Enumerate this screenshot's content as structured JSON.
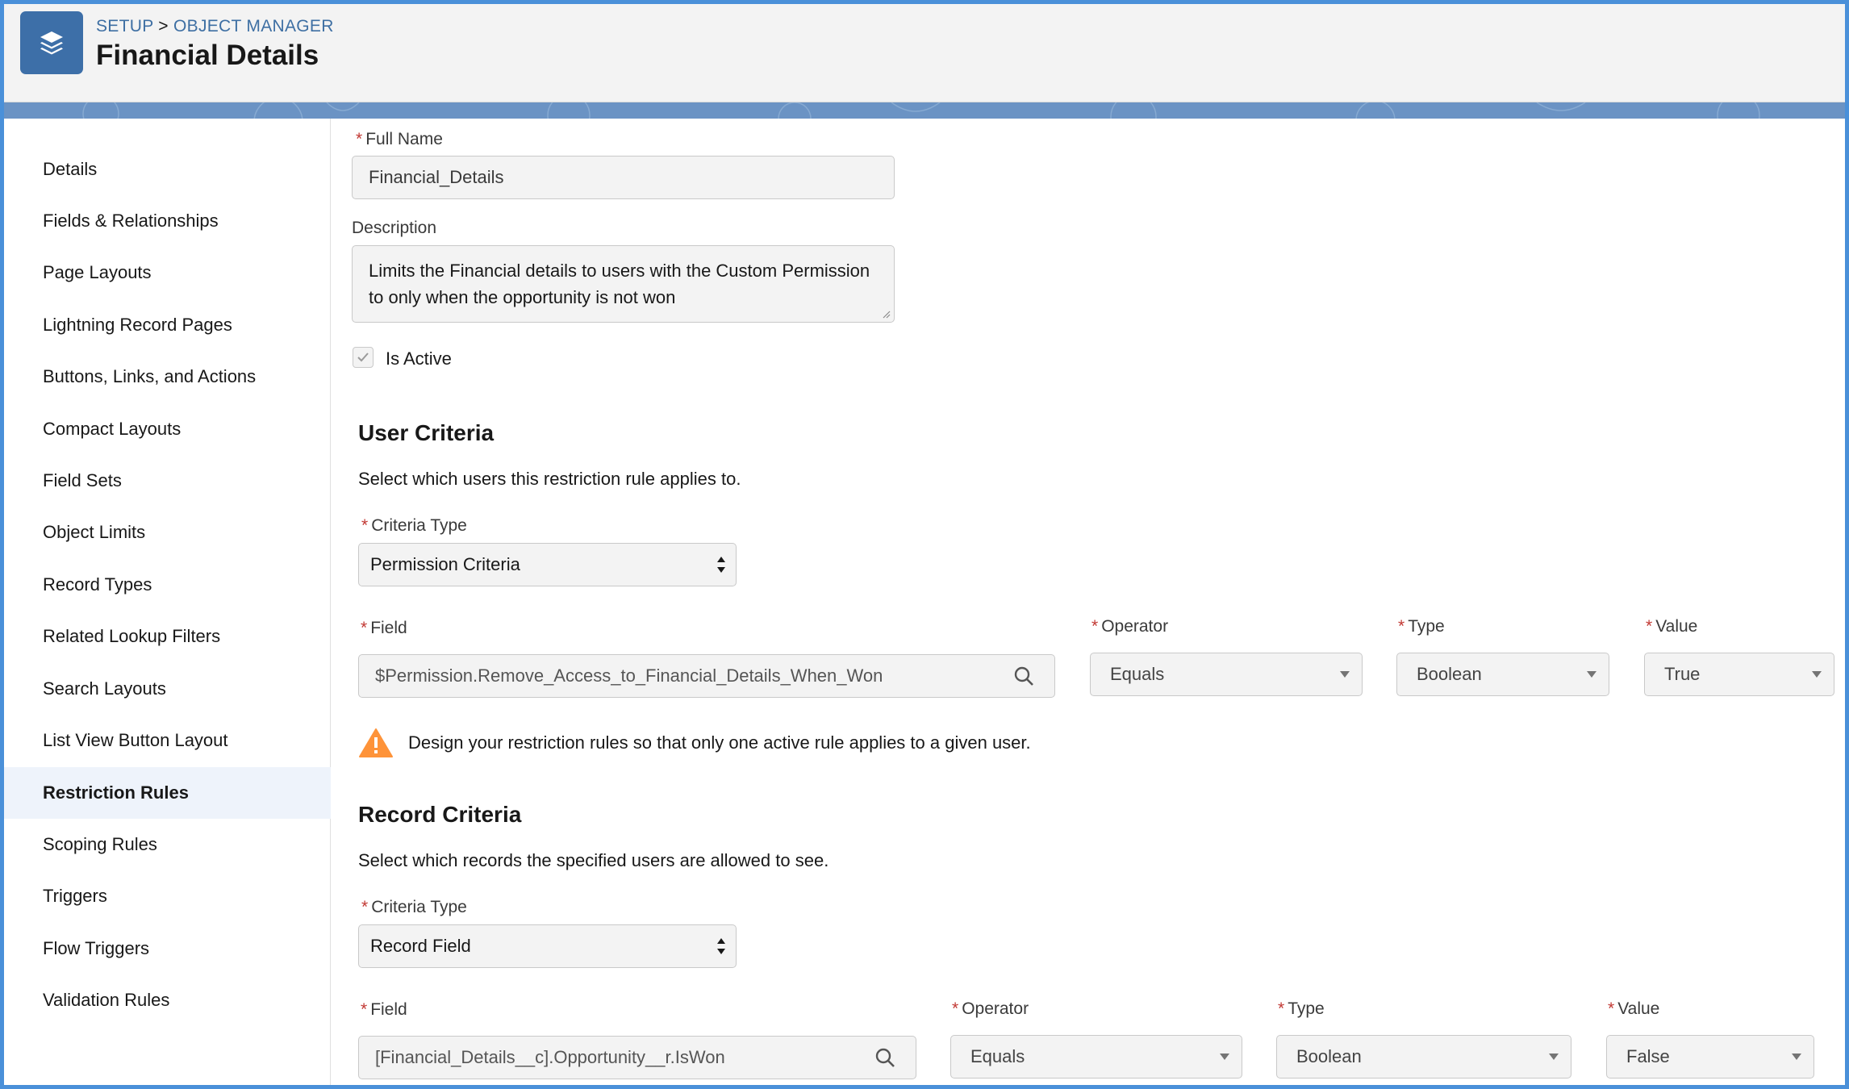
{
  "header": {
    "breadcrumb_root": "SETUP",
    "breadcrumb_sep": ">",
    "breadcrumb_current": "OBJECT MANAGER",
    "title": "Financial Details",
    "icon": "layers-icon"
  },
  "sidebar": {
    "items": [
      {
        "label": "Details"
      },
      {
        "label": "Fields & Relationships"
      },
      {
        "label": "Page Layouts"
      },
      {
        "label": "Lightning Record Pages"
      },
      {
        "label": "Buttons, Links, and Actions"
      },
      {
        "label": "Compact Layouts"
      },
      {
        "label": "Field Sets"
      },
      {
        "label": "Object Limits"
      },
      {
        "label": "Record Types"
      },
      {
        "label": "Related Lookup Filters"
      },
      {
        "label": "Search Layouts"
      },
      {
        "label": "List View Button Layout"
      },
      {
        "label": "Restriction Rules",
        "active": true
      },
      {
        "label": "Scoping Rules"
      },
      {
        "label": "Triggers"
      },
      {
        "label": "Flow Triggers"
      },
      {
        "label": "Validation Rules"
      }
    ]
  },
  "form": {
    "required_mark": "*",
    "full_name_label": "Full Name",
    "full_name_value": "Financial_Details",
    "description_label": "Description",
    "description_value": "Limits the Financial details to users with the Custom Permission to only when the opportunity is not won",
    "is_active_label": "Is Active",
    "is_active_checked": true
  },
  "user_criteria": {
    "title": "User Criteria",
    "description": "Select which users this restriction rule applies to.",
    "criteria_type_label": "Criteria Type",
    "criteria_type_value": "Permission Criteria",
    "field_label": "Field",
    "field_value": "$Permission.Remove_Access_to_Financial_Details_When_Won",
    "operator_label": "Operator",
    "operator_value": "Equals",
    "type_label": "Type",
    "type_value": "Boolean",
    "value_label": "Value",
    "value_value": "True",
    "warning": "Design your restriction rules so that only one active rule applies to a given user."
  },
  "record_criteria": {
    "title": "Record Criteria",
    "description": "Select which records the specified users are allowed to see.",
    "criteria_type_label": "Criteria Type",
    "criteria_type_value": "Record Field",
    "field_label": "Field",
    "field_value": "[Financial_Details__c].Opportunity__r.IsWon",
    "operator_label": "Operator",
    "operator_value": "Equals",
    "type_label": "Type",
    "type_value": "Boolean",
    "value_label": "Value",
    "value_value": "False"
  },
  "colors": {
    "accent": "#3d6fa8",
    "required": "#c23934",
    "warning": "#fe9339",
    "frame": "#4a90d9"
  }
}
